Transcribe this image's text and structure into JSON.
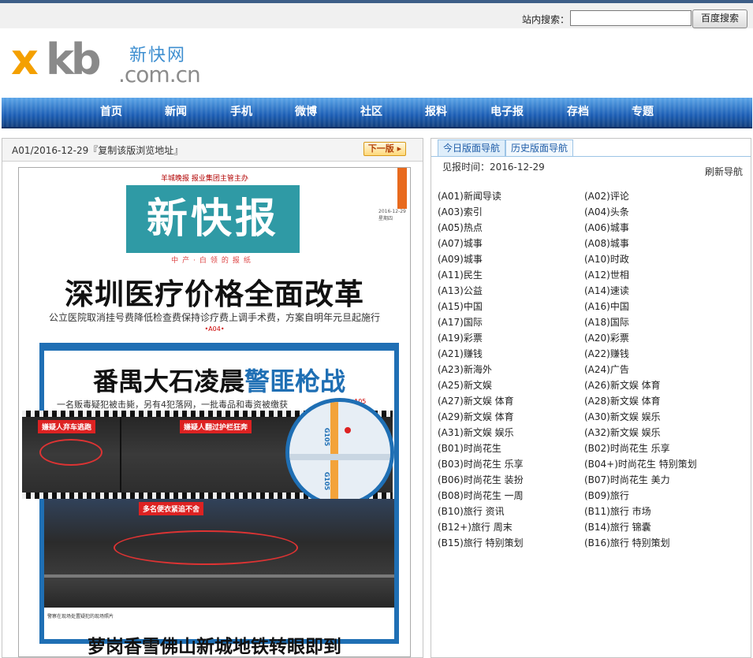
{
  "header": {
    "search_label": "站内搜索：",
    "search_value": "",
    "search_button": "百度搜索",
    "logo_letters": "xkb",
    "logo_cn": "新快网",
    "logo_domain": ".com.cn"
  },
  "nav": [
    "首页",
    "新闻",
    "手机",
    "微博",
    "社区",
    "报料",
    "电子报",
    "存档",
    "专题"
  ],
  "left_panel": {
    "title": "A01/2016-12-29『复制该版浏览地址』",
    "next_button": "下一版",
    "newspaper": {
      "top_note": "羊城晚报 报业集团主管主办",
      "masthead": "新快报",
      "slogan": "中产·白领的报纸",
      "date": "2016-12-29 星期四",
      "headline1": "深圳医疗价格全面改革",
      "subhead1": "公立医院取消挂号费降低检查费保持诊疗费上调手术费，方案自明年元旦起施行",
      "ref1": "•A04•",
      "headline2_a": "番禺大石凌晨",
      "headline2_b": "警匪枪战",
      "subhead2": "一名贩毒疑犯被击毙，另有4犯落网，一批毒品和毒资被缴获",
      "ref2": "•A05",
      "photo_labels": [
        "嫌疑人弃车逃跑",
        "嫌疑人翻过护栏狂奔",
        "多名便衣紧追不舍"
      ],
      "map_labels": [
        "G105",
        "G105"
      ],
      "caption": "警察在现场处置疑犯的现场照片",
      "headline3": "萝岗香雪佛山新城地铁转眼即到"
    }
  },
  "right_panel": {
    "tabs": [
      "今日版面导航",
      "历史版面导航"
    ],
    "date_label": "见报时间：2016-12-29",
    "refresh": "刷新导航",
    "pages": [
      [
        "(A01)新闻导读",
        "(A02)评论"
      ],
      [
        "(A03)索引",
        "(A04)头条"
      ],
      [
        "(A05)热点",
        "(A06)城事"
      ],
      [
        "(A07)城事",
        "(A08)城事"
      ],
      [
        "(A09)城事",
        "(A10)时政"
      ],
      [
        "(A11)民生",
        "(A12)世相"
      ],
      [
        "(A13)公益",
        "(A14)速读"
      ],
      [
        "(A15)中国",
        "(A16)中国"
      ],
      [
        "(A17)国际",
        "(A18)国际"
      ],
      [
        "(A19)彩票",
        "(A20)彩票"
      ],
      [
        "(A21)赚钱",
        "(A22)赚钱"
      ],
      [
        "(A23)新海外",
        "(A24)广告"
      ],
      [
        "(A25)新文娱",
        "(A26)新文娱 体育"
      ],
      [
        "(A27)新文娱 体育",
        "(A28)新文娱 体育"
      ],
      [
        "(A29)新文娱 体育",
        "(A30)新文娱 娱乐"
      ],
      [
        "(A31)新文娱 娱乐",
        "(A32)新文娱 娱乐"
      ],
      [
        "(B01)时尚花生",
        "(B02)时尚花生 乐享"
      ],
      [
        "(B03)时尚花生 乐享",
        "(B04+)时尚花生 特别策划"
      ],
      [
        "(B06)时尚花生 装扮",
        "(B07)时尚花生 美力"
      ],
      [
        "(B08)时尚花生 一周",
        "(B09)旅行"
      ],
      [
        "(B10)旅行 资讯",
        "(B11)旅行 市场"
      ],
      [
        "(B12+)旅行 周末",
        "(B14)旅行 锦囊"
      ],
      [
        "(B15)旅行 特别策划",
        "(B16)旅行 特别策划"
      ]
    ]
  }
}
